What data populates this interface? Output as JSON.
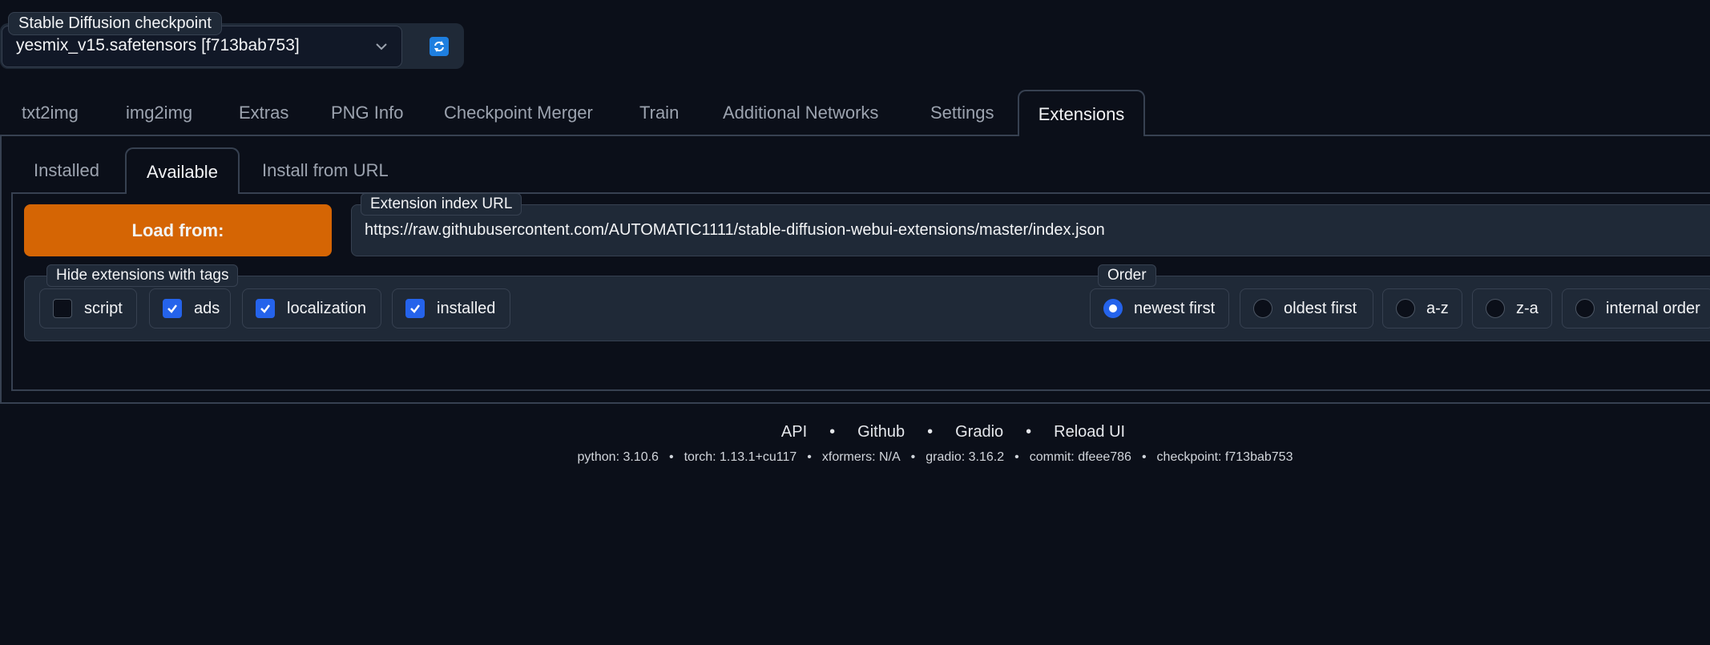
{
  "checkpoint": {
    "label": "Stable Diffusion checkpoint",
    "value": "yesmix_v15.safetensors [f713bab753]",
    "chevron_icon": "chevron-down-icon",
    "refresh_icon": "refresh-icon"
  },
  "main_tabs": [
    {
      "label": "txt2img"
    },
    {
      "label": "img2img"
    },
    {
      "label": "Extras"
    },
    {
      "label": "PNG Info"
    },
    {
      "label": "Checkpoint Merger"
    },
    {
      "label": "Train"
    },
    {
      "label": "Additional Networks"
    },
    {
      "label": "Settings"
    },
    {
      "label": "Extensions",
      "active": true
    }
  ],
  "sub_tabs": [
    {
      "label": "Installed"
    },
    {
      "label": "Available",
      "active": true
    },
    {
      "label": "Install from URL"
    }
  ],
  "load": {
    "button_label": "Load from:",
    "url_label": "Extension index URL",
    "url_value": "https://raw.githubusercontent.com/AUTOMATIC1111/stable-diffusion-webui-extensions/master/index.json"
  },
  "hide_tags": {
    "label": "Hide extensions with tags",
    "options": [
      {
        "label": "script",
        "checked": false
      },
      {
        "label": "ads",
        "checked": true
      },
      {
        "label": "localization",
        "checked": true
      },
      {
        "label": "installed",
        "checked": true
      }
    ]
  },
  "order": {
    "label": "Order",
    "options": [
      {
        "label": "newest first",
        "selected": true
      },
      {
        "label": "oldest first",
        "selected": false
      },
      {
        "label": "a-z",
        "selected": false
      },
      {
        "label": "z-a",
        "selected": false
      },
      {
        "label": "internal order",
        "selected": false
      }
    ]
  },
  "footer": {
    "links": [
      "API",
      "Github",
      "Gradio",
      "Reload UI"
    ],
    "separator": "•",
    "meta": [
      "python: 3.10.6",
      "torch: 1.13.1+cu117",
      "xformers: N/A",
      "gradio: 3.16.2",
      "commit: dfeee786",
      "checkpoint: f713bab753"
    ]
  },
  "colors": {
    "background": "#0b0f19",
    "accent_orange": "#d56504",
    "accent_blue": "#2563eb"
  }
}
